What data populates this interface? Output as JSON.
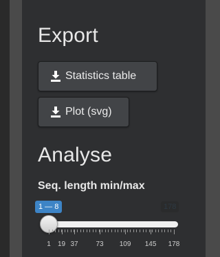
{
  "export": {
    "title": "Export",
    "buttons": [
      {
        "label": "Statistics table",
        "icon": "download-icon"
      },
      {
        "label": "Plot (svg)",
        "icon": "download-icon"
      }
    ]
  },
  "analyse": {
    "title": "Analyse",
    "slider": {
      "label": "Seq. length min/max",
      "range_text": "1 — 8",
      "max_text": "178",
      "min": 1,
      "max": 178,
      "value_low": 1,
      "value_high": 8,
      "tick_labels": [
        "1",
        "19",
        "37",
        "73",
        "109",
        "145",
        "178"
      ],
      "tick_values": [
        1,
        19,
        37,
        73,
        109,
        145,
        178
      ],
      "accent_color": "#3d84c6"
    }
  }
}
